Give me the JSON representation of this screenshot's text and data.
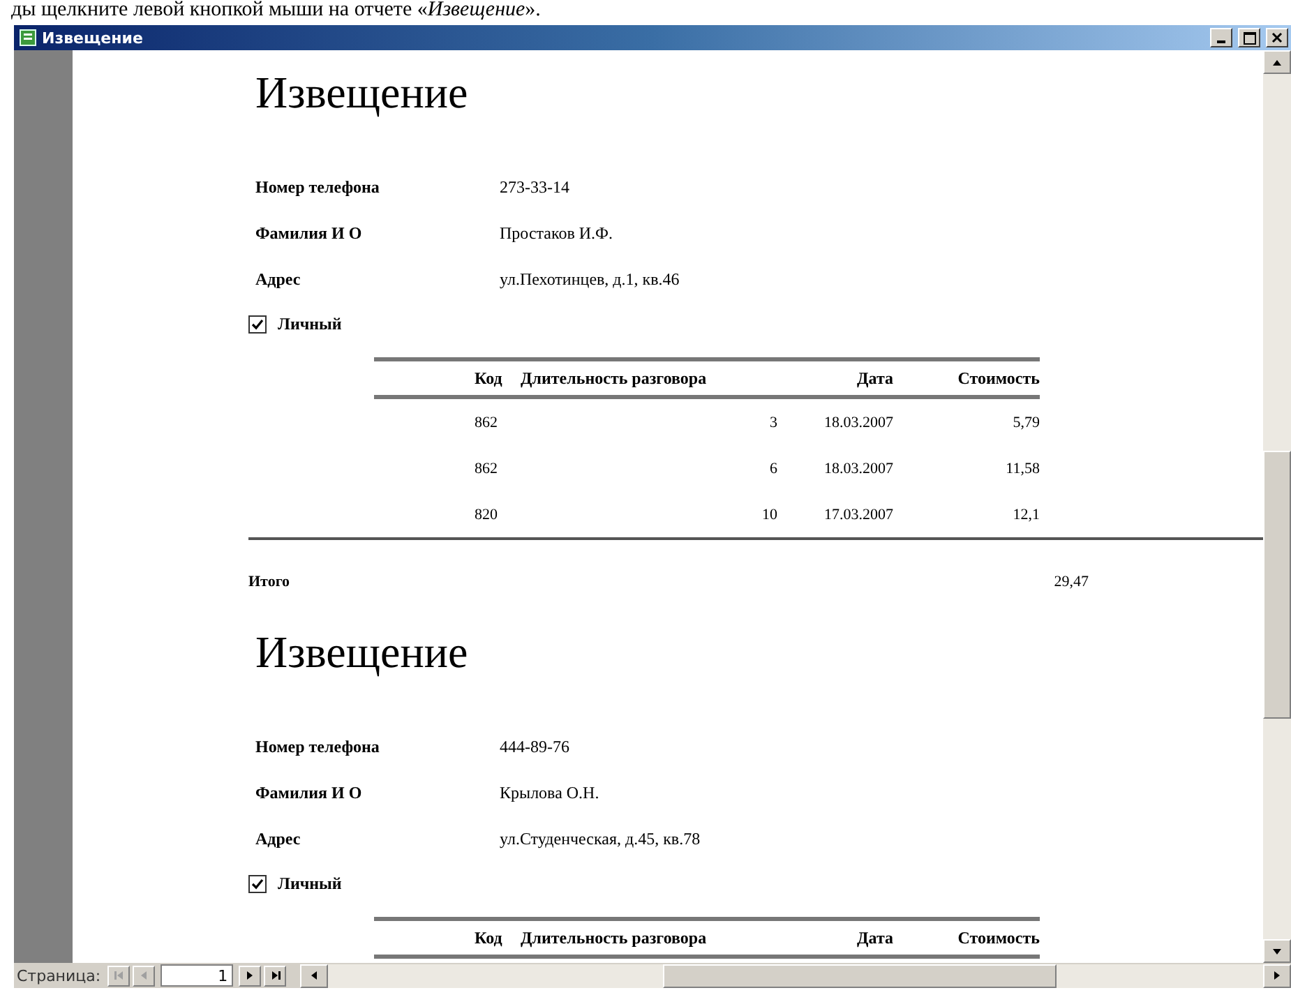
{
  "document_text": "ды щелкните левой кнопкой мыши на отчете «*Извещение*».",
  "window": {
    "title": "Извещение"
  },
  "records": [
    {
      "title": "Извещение",
      "fields": [
        {
          "label": "Номер телефона",
          "value": "273-33-14"
        },
        {
          "label": "Фамилия И О",
          "value": "Простаков И.Ф."
        },
        {
          "label": "Адрес",
          "value": "ул.Пехотинцев, д.1, кв.46"
        }
      ],
      "checkbox": {
        "label": "Личный",
        "checked": true
      },
      "table": {
        "columns": [
          "Код",
          "Длительность разговора",
          "Дата",
          "Стоимость"
        ],
        "rows": [
          [
            "862",
            "3",
            "18.03.2007",
            "5,79"
          ],
          [
            "862",
            "6",
            "18.03.2007",
            "11,58"
          ],
          [
            "820",
            "10",
            "17.03.2007",
            "12,1"
          ]
        ]
      },
      "total": {
        "label": "Итого",
        "value": "29,47"
      }
    },
    {
      "title": "Извещение",
      "fields": [
        {
          "label": "Номер телефона",
          "value": "444-89-76"
        },
        {
          "label": "Фамилия И О",
          "value": "Крылова О.Н."
        },
        {
          "label": "Адрес",
          "value": "ул.Студенческая, д.45, кв.78"
        }
      ],
      "checkbox": {
        "label": "Личный",
        "checked": true
      },
      "table": {
        "columns": [
          "Код",
          "Длительность разговора",
          "Дата",
          "Стоимость"
        ]
      }
    }
  ],
  "navigation": {
    "label": "Страница:",
    "page": "1",
    "buttons": [
      {
        "kind": "first",
        "disabled": true
      },
      {
        "kind": "prev",
        "disabled": true
      },
      {
        "kind": "next",
        "disabled": false
      },
      {
        "kind": "last",
        "disabled": false
      }
    ]
  }
}
